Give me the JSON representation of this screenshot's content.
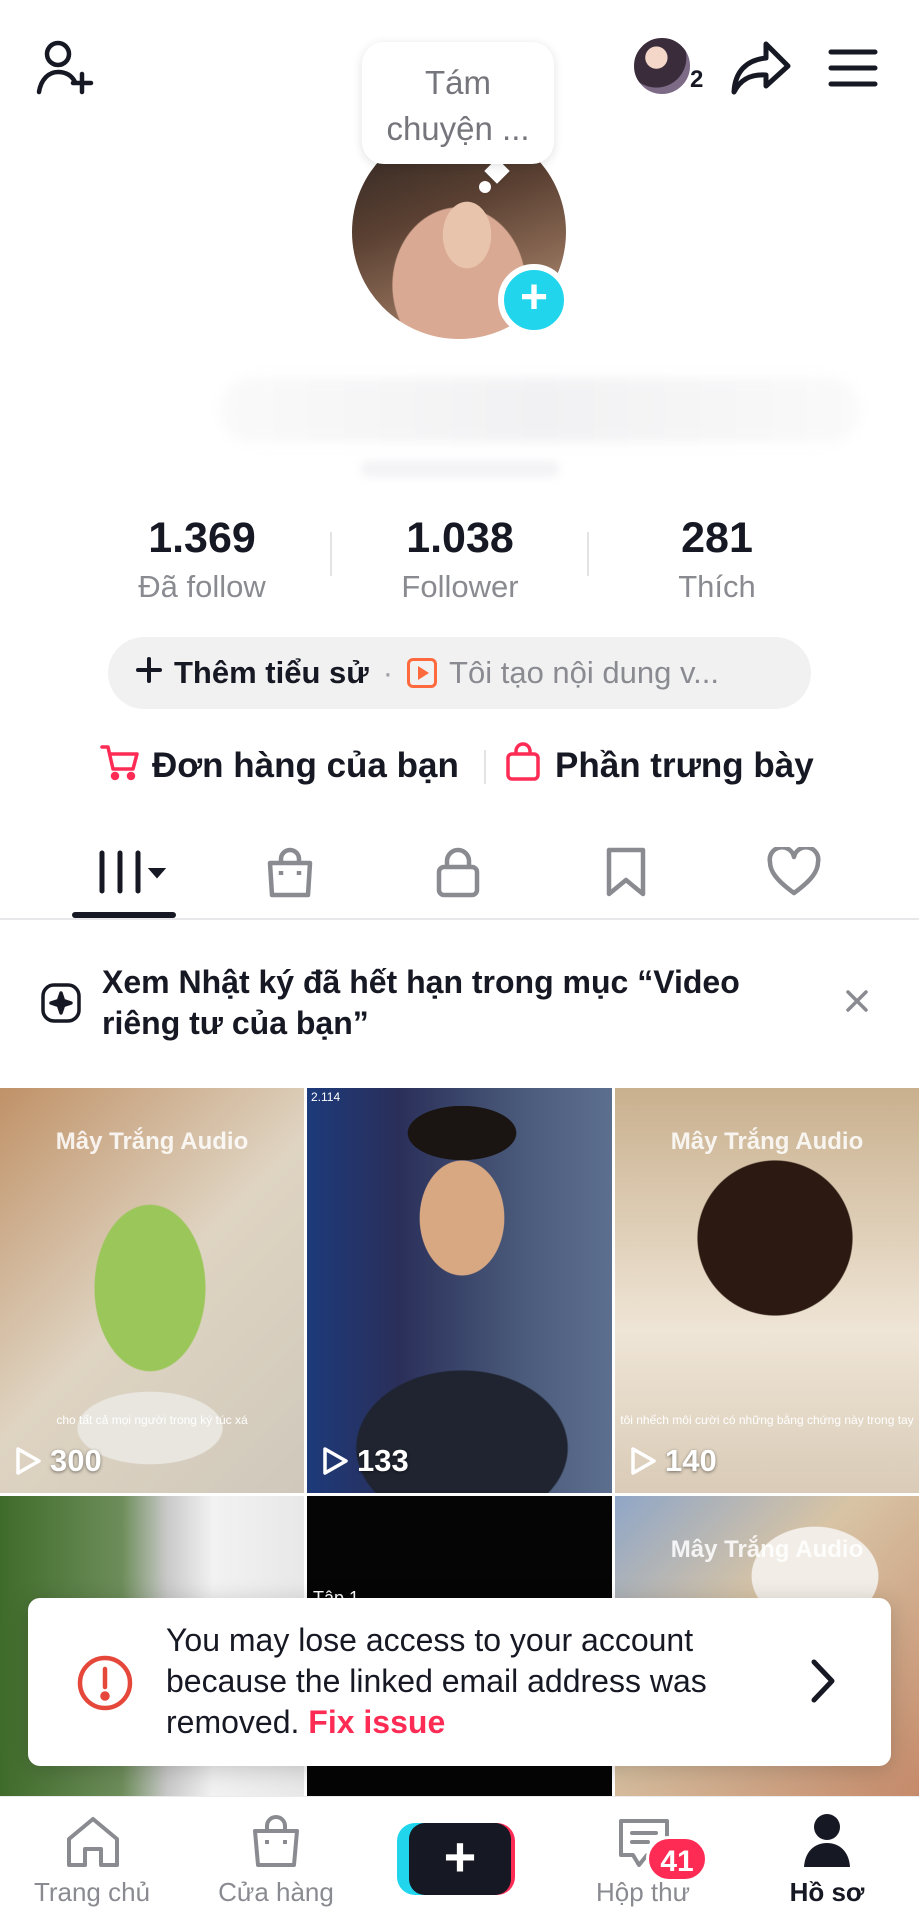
{
  "header": {
    "bubble_line1": "Tám",
    "bubble_line2": "chuyện ...",
    "stack_count": "2"
  },
  "stats": [
    {
      "value": "1.369",
      "label": "Đã follow"
    },
    {
      "value": "1.038",
      "label": "Follower"
    },
    {
      "value": "281",
      "label": "Thích"
    }
  ],
  "bio": {
    "add_label": "Thêm tiểu sử",
    "separator": "·",
    "creator_text": "Tôi tạo nội dung v..."
  },
  "shop": {
    "orders_label": "Đơn hàng của bạn",
    "showcase_label": "Phần trưng bày"
  },
  "notice": {
    "text": "Xem Nhật ký đã hết hạn trong mục “Video riêng tư của bạn”"
  },
  "videos": [
    {
      "views": "300",
      "watermark": "Mây Trắng Audio",
      "caption": "cho tất cả mọi người trong ký túc xá"
    },
    {
      "views": "133",
      "watermark": "",
      "caption": ""
    },
    {
      "views": "140",
      "watermark": "Mây Trắng Audio",
      "caption": "tôi nhếch môi cười có những bằng chứng này trong tay"
    },
    {
      "views": "",
      "watermark": "",
      "caption": ""
    },
    {
      "views": "",
      "watermark": "",
      "caption": ""
    },
    {
      "views": "",
      "watermark": "Mây Trắng Audio",
      "caption": ""
    }
  ],
  "tile_texts": {
    "tap_label": "Tập 1",
    "small_tag": "2.114"
  },
  "warning": {
    "message": "You may lose access to your account because the linked email address was removed.",
    "fix_label": "Fix issue"
  },
  "bottom_nav": {
    "home": "Trang chủ",
    "shop": "Cửa hàng",
    "inbox": "Hộp thư",
    "inbox_badge": "41",
    "profile": "Hồ sơ"
  },
  "colors": {
    "accent_red": "#fe2c55",
    "accent_cyan": "#20d5ec",
    "text_primary": "#161823",
    "text_secondary": "#8a8b91"
  },
  "icons": {
    "top_left": "add-friend-icon",
    "share": "share-icon",
    "menu": "hamburger-menu-icon",
    "tabs": [
      "videos-grid-icon",
      "shop-bag-icon",
      "lock-icon",
      "bookmark-icon",
      "heart-icon"
    ]
  }
}
